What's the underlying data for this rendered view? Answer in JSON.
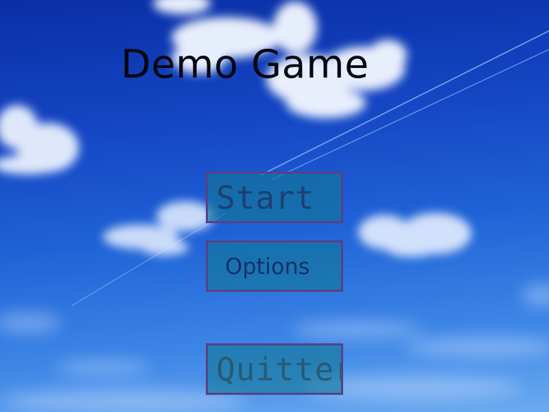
{
  "game": {
    "title": "Demo Game"
  },
  "menu": {
    "start_label": "Start",
    "options_label": "Options",
    "quit_label": "Quitter"
  },
  "colors": {
    "sky_top": "#0a2fa6",
    "sky_bottom": "#6aaaf0",
    "button_fill": "#12789a",
    "button_border": "#5a3f86",
    "title_text": "#050810"
  }
}
